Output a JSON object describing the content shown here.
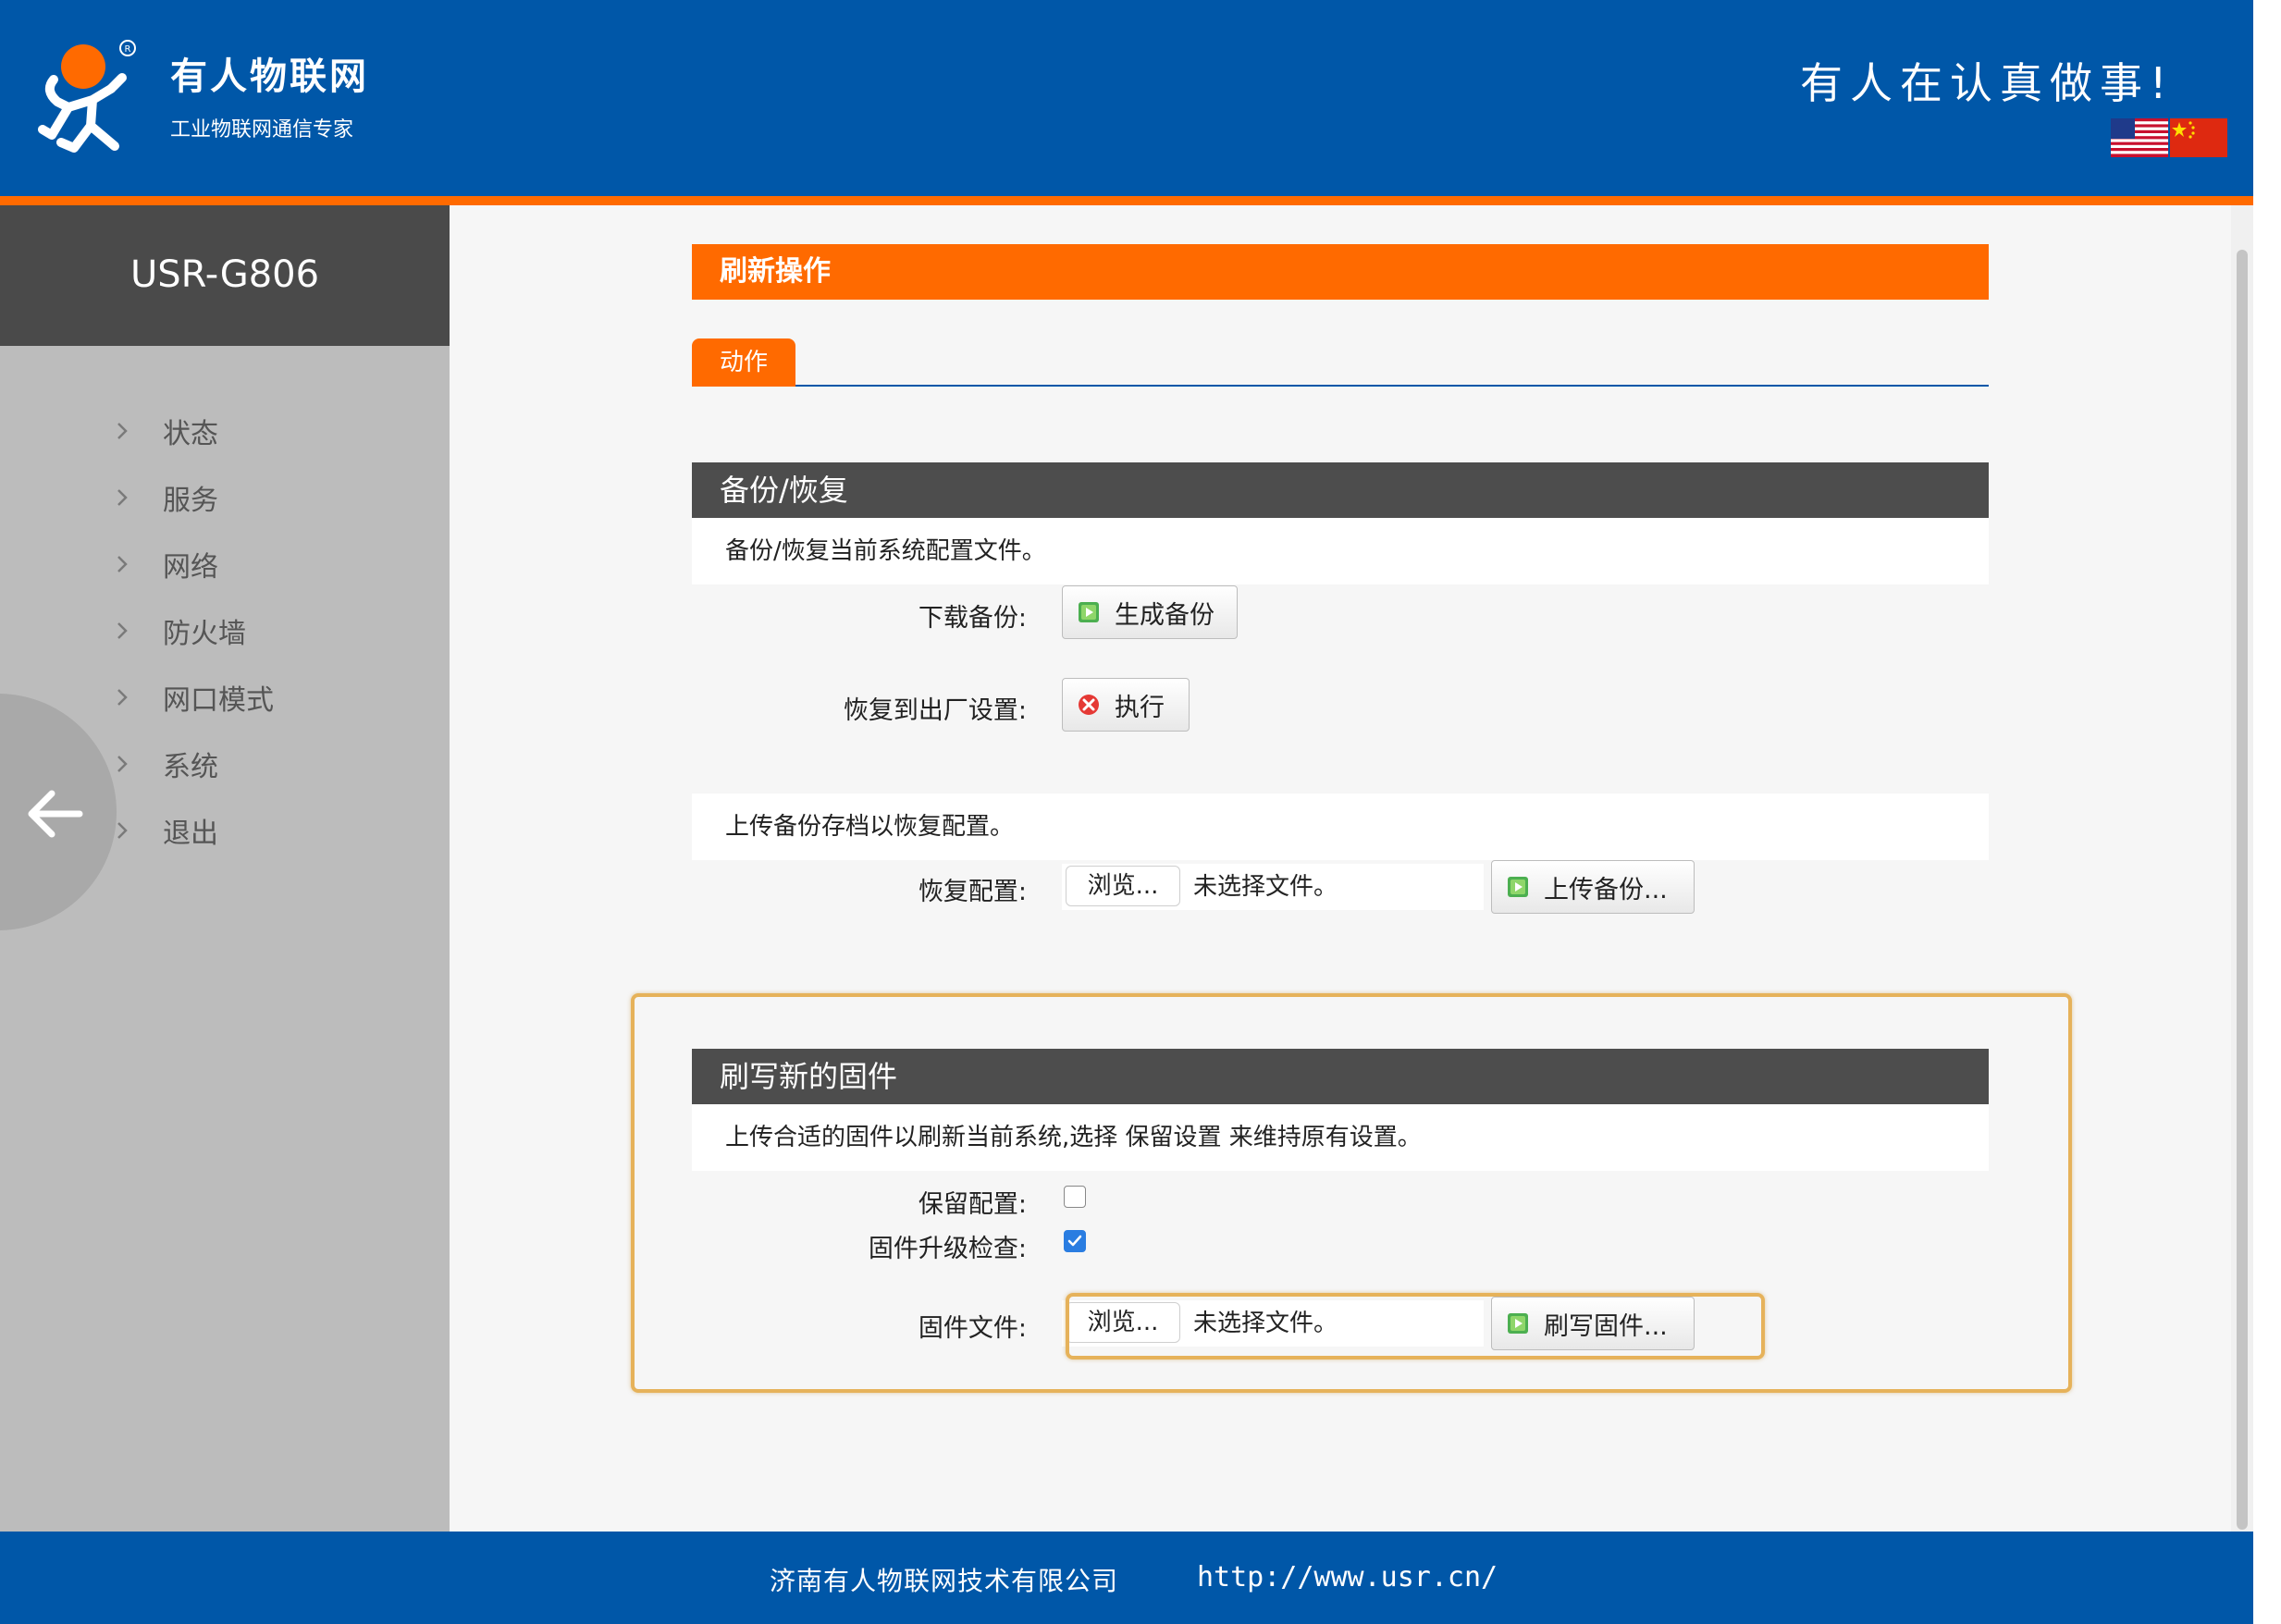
{
  "header": {
    "brand_name": "有人物联网",
    "brand_sub": "工业物联网通信专家",
    "slogan": "有人在认真做事!",
    "colors": {
      "blue": "#0057a8",
      "orange": "#ff6a00"
    },
    "flags": [
      "flag-us-icon",
      "flag-cn-icon"
    ]
  },
  "sidebar": {
    "device": "USR-G806",
    "items": [
      {
        "label": "状态"
      },
      {
        "label": "服务"
      },
      {
        "label": "网络"
      },
      {
        "label": "防火墙"
      },
      {
        "label": "网口模式"
      },
      {
        "label": "系统"
      },
      {
        "label": "退出"
      }
    ]
  },
  "main": {
    "title": "刷新操作",
    "tab": "动作",
    "backup": {
      "heading": "备份/恢复",
      "desc": "备份/恢复当前系统配置文件。",
      "download_label": "下载备份:",
      "generate_button": "生成备份",
      "reset_label": "恢复到出厂设置:",
      "execute_button": "执行",
      "upload_desc": "上传备份存档以恢复配置。",
      "restore_label": "恢复配置:",
      "browse": "浏览...",
      "no_file": "未选择文件。",
      "upload_button": "上传备份..."
    },
    "firmware": {
      "heading": "刷写新的固件",
      "desc": "上传合适的固件以刷新当前系统,选择 保留设置 来维持原有设置。",
      "keep_label": "保留配置:",
      "keep_checked": false,
      "check_label": "固件升级检查:",
      "check_checked": true,
      "file_label": "固件文件:",
      "browse": "浏览...",
      "no_file": "未选择文件。",
      "flash_button": "刷写固件..."
    }
  },
  "footer": {
    "company": "济南有人物联网技术有限公司",
    "url": "http://www.usr.cn/"
  }
}
